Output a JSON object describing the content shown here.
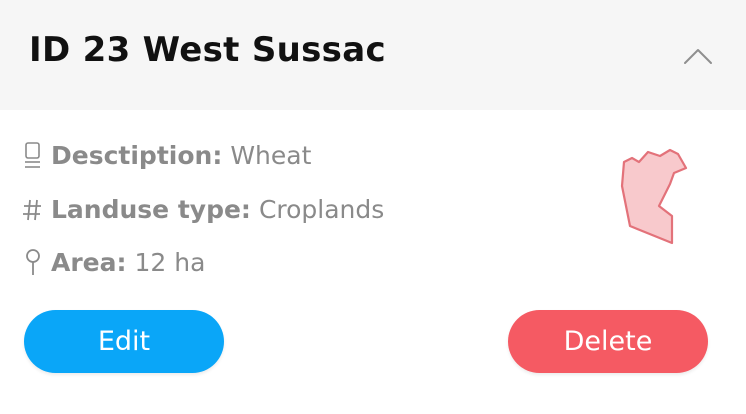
{
  "colors": {
    "header_bg": "#f6f6f6",
    "title": "#111111",
    "text_muted": "#8a8a8a",
    "edit_button": "#0aa6f8",
    "delete_button": "#f55a63",
    "shape_fill": "#f8c9cc",
    "shape_stroke": "#e3727a"
  },
  "header": {
    "title": "ID 23 West Sussac",
    "collapse_icon": "chevron-up-icon"
  },
  "details": {
    "description": {
      "icon": "document-icon",
      "label": "Desctiption:",
      "value": "Wheat"
    },
    "landuse": {
      "icon": "hash-icon",
      "label": "Landuse type:",
      "value": "Croplands"
    },
    "area": {
      "icon": "location-pin-icon",
      "label": "Area:",
      "value": "12 ha"
    }
  },
  "shape_preview": {
    "icon": "field-polygon-icon"
  },
  "actions": {
    "edit_label": "Edit",
    "delete_label": "Delete"
  }
}
